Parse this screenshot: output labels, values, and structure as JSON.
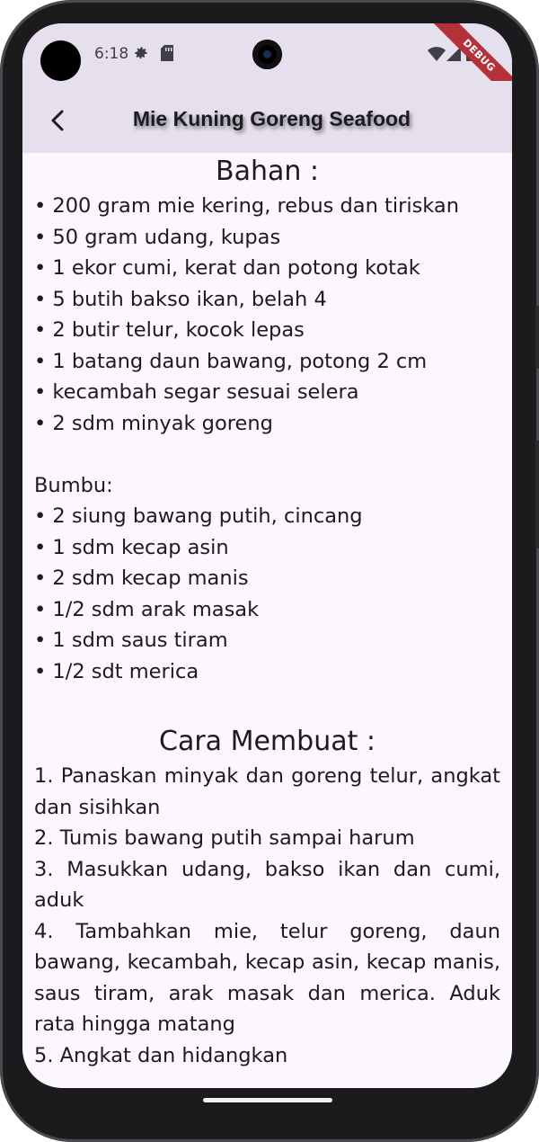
{
  "status_bar": {
    "time": "6:18",
    "icons": [
      "settings-icon",
      "sd-card-icon",
      "wifi-icon",
      "signal-icon",
      "battery-icon"
    ]
  },
  "debug_banner": "DEBUG",
  "app_bar": {
    "back_icon": "arrow-back-icon",
    "title": "Mie Kuning Goreng Seafood"
  },
  "colors": {
    "app_bar_bg": "#e5dfee",
    "page_bg": "#fcf6fd",
    "debug_banner": "#b3323a"
  },
  "ingredients": {
    "heading": "Bahan :",
    "items": [
      "• 200 gram mie kering, rebus dan tiriskan",
      "• 50 gram udang, kupas",
      "• 1 ekor cumi, kerat dan potong kotak",
      "• 5 butih bakso ikan, belah 4",
      "• 2 butir telur, kocok lepas",
      "• 1 batang daun bawang, potong 2 cm",
      "• kecambah segar sesuai selera",
      "• 2 sdm minyak goreng"
    ],
    "spice_label": "Bumbu:",
    "spices": [
      "• 2 siung bawang putih, cincang",
      "• 1 sdm kecap asin",
      "• 2 sdm kecap manis",
      "• 1/2 sdm arak masak",
      "• 1 sdm saus tiram",
      "• 1/2 sdt merica"
    ]
  },
  "steps": {
    "heading": "Cara Membuat :",
    "items": [
      "1. Panaskan minyak dan goreng telur, angkat dan sisihkan",
      "2. Tumis bawang putih sampai harum",
      "3. Masukkan udang, bakso ikan dan cumi, aduk",
      "4. Tambahkan mie, telur goreng, daun bawang, kecambah, kecap asin, kecap manis, saus tiram, arak masak dan merica. Aduk rata hingga matang",
      "5. Angkat dan hidangkan"
    ]
  }
}
